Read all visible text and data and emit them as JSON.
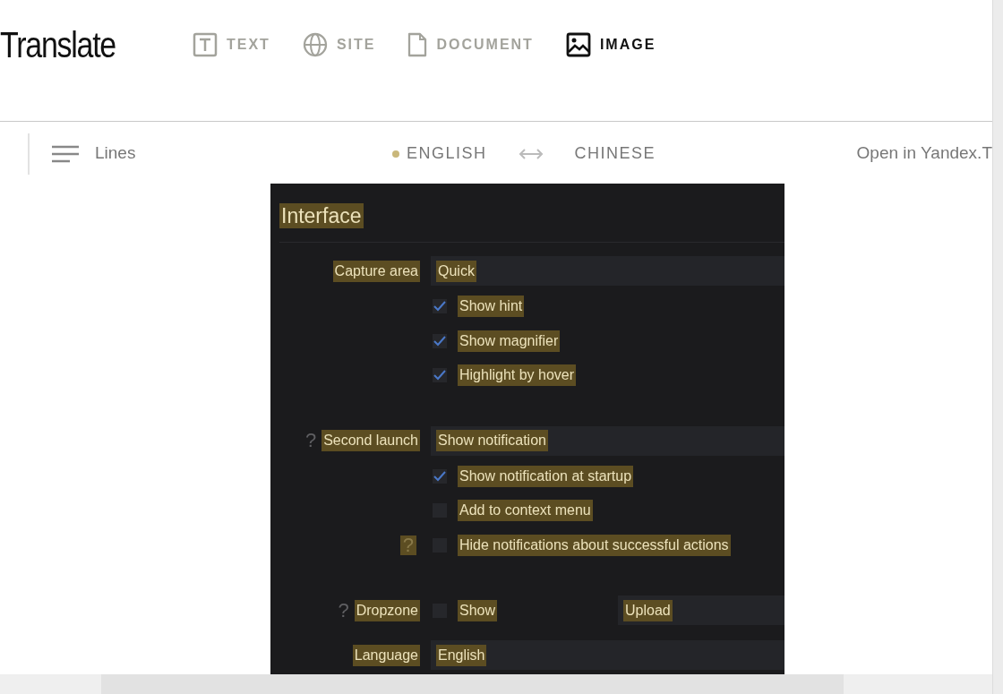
{
  "header": {
    "logo": "Translate",
    "tabs": [
      {
        "label": "TEXT",
        "kind": "text",
        "selected": false
      },
      {
        "label": "SITE",
        "kind": "site",
        "selected": false
      },
      {
        "label": "DOCUMENT",
        "kind": "document",
        "selected": false
      },
      {
        "label": "IMAGE",
        "kind": "image",
        "selected": true
      }
    ]
  },
  "toolbar": {
    "view_mode": "Lines",
    "source_language": "ENGLISH",
    "target_language": "CHINESE",
    "open_link": "Open in Yandex.T"
  },
  "image": {
    "title": "Interface",
    "sections": [
      [
        {
          "kind": "select",
          "label": "Capture area",
          "value": "Quick"
        },
        {
          "kind": "checkbox",
          "label": "Show hint",
          "checked": true
        },
        {
          "kind": "checkbox",
          "label": "Show magnifier",
          "checked": true
        },
        {
          "kind": "checkbox",
          "label": "Highlight by hover",
          "checked": true
        }
      ],
      [
        {
          "kind": "select",
          "label": "Second launch",
          "value": "Show notification",
          "help": {
            "text": "?",
            "highlighted": false
          }
        },
        {
          "kind": "checkbox",
          "label": "Show notification at startup",
          "checked": true
        },
        {
          "kind": "checkbox",
          "label": "Add to context menu",
          "checked": false
        },
        {
          "kind": "checkbox",
          "label": "Hide notifications about successful actions",
          "checked": false,
          "help": {
            "text": "?",
            "highlighted": true
          }
        }
      ],
      [
        {
          "kind": "toggle_field",
          "label": "Dropzone",
          "help": {
            "text": "?",
            "highlighted": false
          },
          "option": "Show",
          "checked": false,
          "value": "Upload"
        },
        {
          "kind": "select",
          "label": "Language",
          "value": "English"
        }
      ]
    ]
  }
}
